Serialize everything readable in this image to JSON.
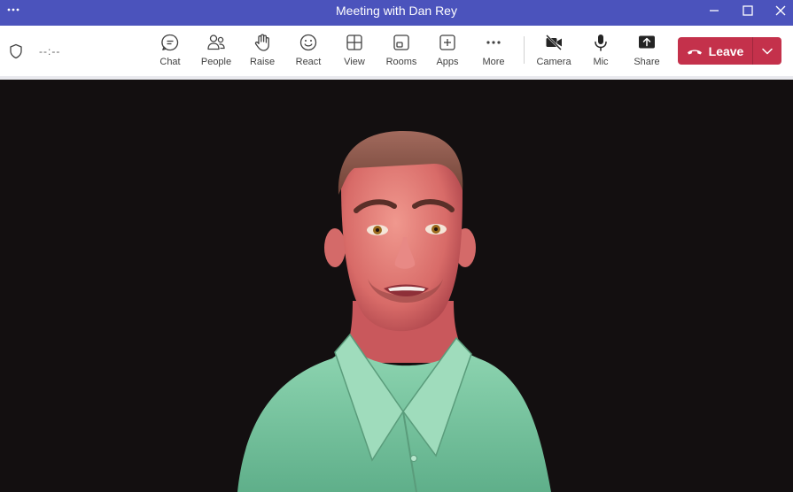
{
  "window": {
    "title": "Meeting with Dan Rey",
    "menu_icon": "more-dots-icon",
    "controls": [
      "minimize-icon",
      "maximize-icon",
      "close-icon"
    ]
  },
  "toolbar": {
    "timer": "--:--",
    "buttons": [
      {
        "label": "Chat",
        "icon": "chat-icon"
      },
      {
        "label": "People",
        "icon": "people-icon"
      },
      {
        "label": "Raise",
        "icon": "raise-hand-icon"
      },
      {
        "label": "React",
        "icon": "smiley-icon"
      },
      {
        "label": "View",
        "icon": "grid-view-icon"
      },
      {
        "label": "Rooms",
        "icon": "rooms-icon"
      },
      {
        "label": "Apps",
        "icon": "add-apps-icon"
      },
      {
        "label": "More",
        "icon": "more-dots-icon"
      },
      {
        "label": "Camera",
        "icon": "camera-off-icon"
      },
      {
        "label": "Mic",
        "icon": "microphone-icon"
      },
      {
        "label": "Share",
        "icon": "share-screen-icon"
      }
    ],
    "leave": {
      "label": "Leave",
      "icon": "hang-up-icon"
    }
  },
  "colors": {
    "titlebar": "#4b53bc",
    "leave_button": "#c4314b",
    "stage_background": "#130f10",
    "avatar_shirt": "#7ec9a4"
  }
}
